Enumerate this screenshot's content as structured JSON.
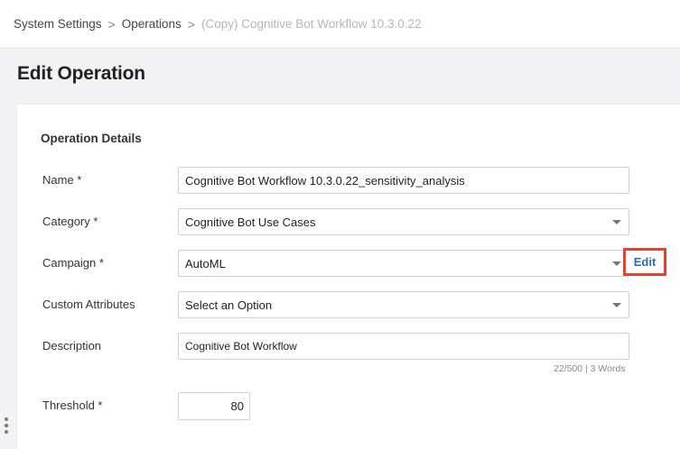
{
  "breadcrumb": {
    "items": [
      "System Settings",
      "Operations"
    ],
    "current": "(Copy) Cognitive Bot Workflow 10.3.0.22",
    "separator": ">"
  },
  "page": {
    "title": "Edit Operation"
  },
  "form": {
    "section_title": "Operation Details",
    "name": {
      "label": "Name *",
      "value": "Cognitive Bot Workflow 10.3.0.22_sensitivity_analysis"
    },
    "category": {
      "label": "Category *",
      "value": "Cognitive Bot Use Cases"
    },
    "campaign": {
      "label": "Campaign *",
      "value": "AutoML",
      "edit_label": "Edit"
    },
    "custom_attributes": {
      "label": "Custom Attributes",
      "value": "Select an Option"
    },
    "description": {
      "label": "Description",
      "value": "Cognitive Bot Workflow",
      "counter": "22/500 | 3 Words"
    },
    "threshold": {
      "label": "Threshold *",
      "value": "80"
    }
  },
  "colors": {
    "accent_link": "#2a6fb5",
    "highlight_box": "#e8402b",
    "background": "#f3f3f5"
  }
}
